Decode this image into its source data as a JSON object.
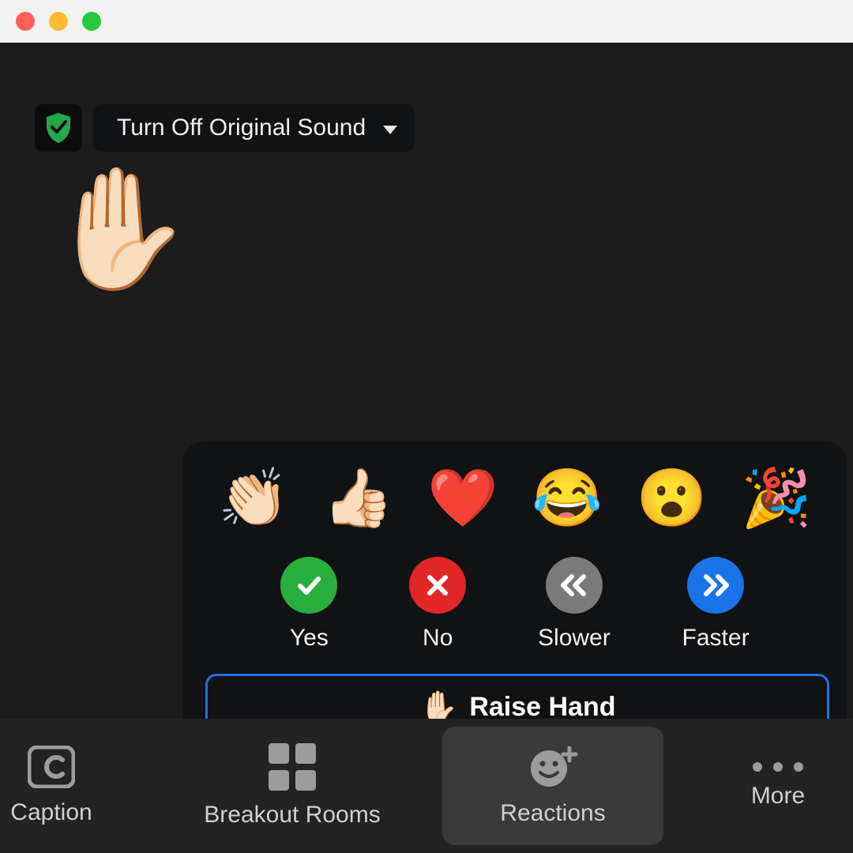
{
  "sound_dropdown": {
    "label": "Turn Off Original Sound"
  },
  "raised_hand_indicator": {
    "emoji": "✋🏻"
  },
  "reactions_popover": {
    "emojis": [
      {
        "name": "clap",
        "char": "👏🏻"
      },
      {
        "name": "thumbs",
        "char": "👍🏻"
      },
      {
        "name": "heart",
        "char": "❤️"
      },
      {
        "name": "joy",
        "char": "😂"
      },
      {
        "name": "wow",
        "char": "😮"
      },
      {
        "name": "tada",
        "char": "🎉"
      }
    ],
    "feedback": {
      "yes": {
        "label": "Yes"
      },
      "no": {
        "label": "No"
      },
      "slower": {
        "label": "Slower"
      },
      "faster": {
        "label": "Faster"
      }
    },
    "raise_hand": {
      "emoji": "✋🏻",
      "label": "Raise Hand"
    }
  },
  "toolbar": {
    "caption": {
      "label": "Caption"
    },
    "breakout": {
      "label": "Breakout Rooms"
    },
    "reactions": {
      "label": "Reactions"
    },
    "more": {
      "label": "More"
    }
  },
  "colors": {
    "green": "#27ae3c",
    "red": "#e02626",
    "gray": "#7a7a7a",
    "blue": "#1b73e8",
    "accent": "#1b73e8"
  }
}
